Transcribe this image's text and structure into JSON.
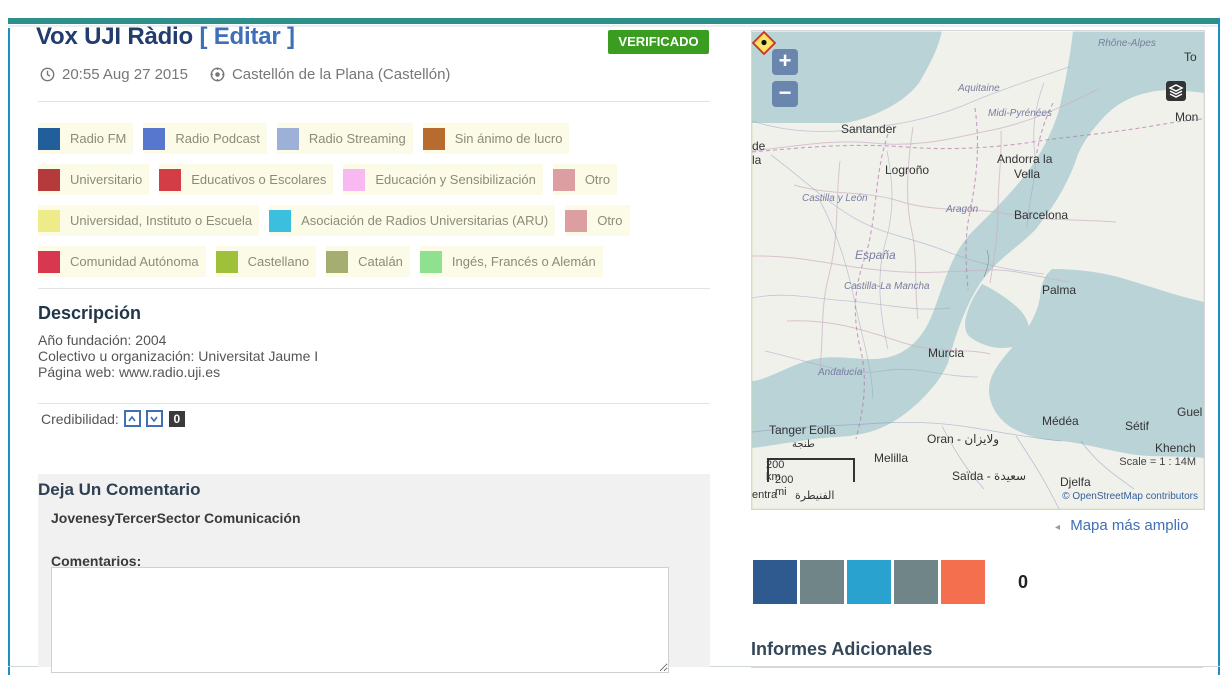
{
  "title": "Vox UJI Ràdio",
  "edit_label": "Editar",
  "verified_label": "VERIFICADO",
  "meta": {
    "time": "20:55 Aug 27 2015",
    "location": "Castellón de la Plana (Castellón)"
  },
  "categories": [
    [
      {
        "label": "Radio FM",
        "color": "#225f9a"
      },
      {
        "label": "Radio Podcast",
        "color": "#5777cf"
      },
      {
        "label": "Radio Streaming",
        "color": "#9cb0d8"
      },
      {
        "label": "Sin ánimo de lucro",
        "color": "#b86b2f"
      }
    ],
    [
      {
        "label": "Universitario",
        "color": "#b53a3c"
      },
      {
        "label": "Educativos o Escolares",
        "color": "#d33d46"
      },
      {
        "label": "Educación y Sensibilización",
        "color": "#f7b9f0"
      },
      {
        "label": "Otro",
        "color": "#dd9ea1"
      }
    ],
    [
      {
        "label": "Universidad, Instituto o Escuela",
        "color": "#edeb8a"
      },
      {
        "label": "Asociación de Radios Universitarias (ARU)",
        "color": "#3bbfde"
      },
      {
        "label": "Otro",
        "color": "#dd9ea1"
      }
    ],
    [
      {
        "label": "Comunidad Autónoma",
        "color": "#d7384f"
      },
      {
        "label": "Castellano",
        "color": "#9fc03b"
      },
      {
        "label": "Catalán",
        "color": "#a6ad70"
      },
      {
        "label": "Ingés, Francés o Alemán",
        "color": "#8fe08f"
      }
    ]
  ],
  "description": {
    "heading": "Descripción",
    "lines": [
      "Año fundación: 2004",
      "Colectivo u organización: Universitat Jaume I",
      "Página web: www.radio.uji.es"
    ]
  },
  "credibility": {
    "label": "Credibilidad:",
    "count": "0"
  },
  "comment": {
    "heading": "Deja Un Comentario",
    "author": "JovenesyTercerSector Comunicación",
    "label": "Comentarios:",
    "value": ""
  },
  "map": {
    "zoom_in": "+",
    "zoom_out": "−",
    "labels": {
      "rhone_alpes": "Rhône-Alpes",
      "aquitaine": "Aquitaine",
      "midi_pyrenees": "Midi-Pyrénées",
      "mon": "Mon",
      "to": "To",
      "santander": "Santander",
      "de": "de",
      "la": "la",
      "logrono": "Logroño",
      "andorra_la": "Andorra la",
      "vella": "Vella",
      "castilla_y_leon": "Castilla y León",
      "aragon": "Aragón",
      "barcelona": "Barcelona",
      "espana": "España",
      "castilla_la_mancha": "Castilla-La Mancha",
      "palma": "Palma",
      "murcia": "Murcia",
      "andalucia": "Andalucía",
      "tanger": "Tanger Eolla",
      "tanger_ar": "طنجة",
      "oran": "Oran - ولايزان",
      "medea": "Médéa",
      "setif": "Sétif",
      "guel": "Guel",
      "khench": "Khench",
      "melilla": "Melilla",
      "saida": "Saïda - سعيدة",
      "djelfa": "Djelfa",
      "entra": "entra",
      "ukm": "الفنيطرة"
    },
    "scale_km": "200 km",
    "scale_mi": "200 mi",
    "scale_ratio": "Scale = 1 : 14M",
    "attribution": "© OpenStreetMap contributors",
    "link": "Mapa más amplio"
  },
  "share": {
    "count": "0",
    "colors": [
      "#2e5a8f",
      "#6f8588",
      "#2aa2d0",
      "#6f8588",
      "#f36f4e"
    ]
  },
  "additional": {
    "heading": "Informes Adicionales"
  }
}
